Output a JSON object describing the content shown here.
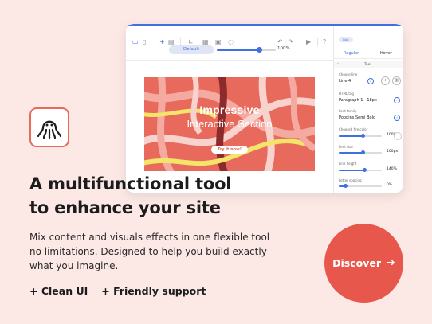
{
  "editor": {
    "zoom": {
      "preset": "Default",
      "value_label": "100%",
      "level": 0.72
    },
    "canvas": {
      "title": "Impressive",
      "subtitle": "Interactive Section",
      "button": "Try it now!"
    },
    "panel": {
      "pill": "Bloc",
      "tabs": [
        "Regular",
        "Hover"
      ],
      "tool_header": "Tool",
      "back_icon": "chevron-left-icon",
      "fields": {
        "choose_line_label": "Choose line",
        "choose_line_value": "Line 4",
        "html_tag_label": "HTML tag",
        "html_tag_value": "Paragraph 1 - 18px",
        "font_family_label": "Font family",
        "font_family_value": "Poppins Semi Bold",
        "font_color_label": "Choosed fire color",
        "font_color_value": "100%",
        "font_size_label": "Font size",
        "font_size_value": "100px",
        "line_height_label": "Line height",
        "line_height_value": "140%",
        "letter_spacing_label": "Letter spacing",
        "letter_spacing_value": "0%"
      },
      "levels": {
        "color": 0.55,
        "font_size": 0.55,
        "line_height": 0.6,
        "letter_spacing": 0.15
      }
    }
  },
  "marketing": {
    "logo_icon": "octopus-icon",
    "headline_line1": "A multifunctional tool",
    "headline_line2": "to enhance your site",
    "body_line1": "Mix content and visuals effects in one flexible tool",
    "body_line2": "no limitations. Designed to help you build exactly",
    "body_line3": "what you imagine.",
    "features": [
      "+ Clean UI",
      "+ Friendly support"
    ],
    "cta_label": "Discover",
    "cta_icon": "arrow-right-icon"
  },
  "colors": {
    "background": "#fce9e6",
    "accent_blue": "#3f6fe0",
    "coral": "#e8574b",
    "canvas_bg": "#e86a5d"
  }
}
